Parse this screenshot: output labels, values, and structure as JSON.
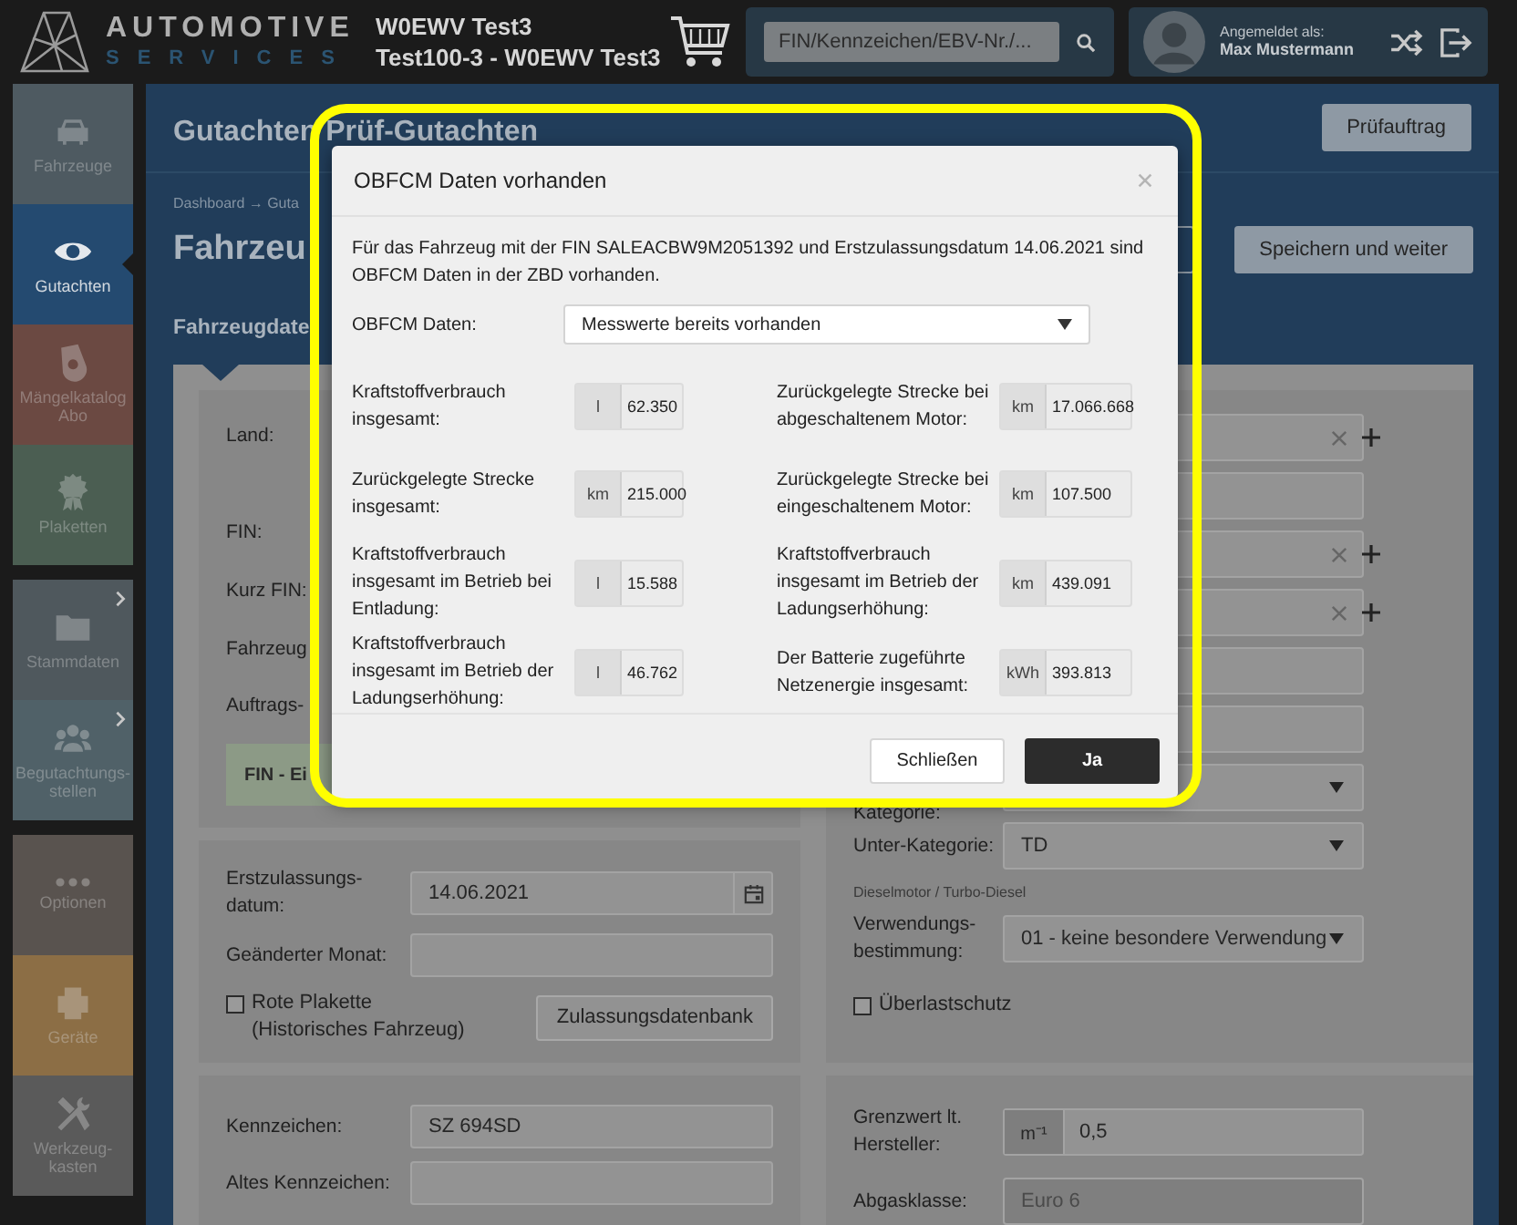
{
  "header": {
    "logo": {
      "name": "AUTOMOTIVE",
      "tagline": "SERVICES"
    },
    "context_lines": [
      "W0EWV Test3",
      "Test100-3 - W0EWV Test3"
    ],
    "search": {
      "placeholder": "FIN/Kennzeichen/EBV-Nr./..."
    },
    "user": {
      "caption": "Angemeldet als:",
      "name": "Max Mustermann"
    }
  },
  "sidebar": {
    "groups": [
      {
        "items": [
          {
            "label": "Fahrzeuge",
            "color": "#4e5a61",
            "selected": false,
            "expandable": false
          },
          {
            "label": "Gutachten",
            "color": "#244a70",
            "selected": true,
            "expandable": false
          },
          {
            "label": "Mängelkatalog Abo",
            "color": "#6b4942",
            "selected": false,
            "expandable": false
          },
          {
            "label": "Plaketten",
            "color": "#4b5e52",
            "selected": false,
            "expandable": false
          }
        ]
      },
      {
        "items": [
          {
            "label": "Stammdaten",
            "color": "#4f585d",
            "selected": false,
            "expandable": true
          },
          {
            "label": "Begutachtungs-stellen",
            "color": "#506168",
            "selected": false,
            "expandable": true
          }
        ]
      },
      {
        "items": [
          {
            "label": "Optionen",
            "color": "#59534f",
            "selected": false,
            "expandable": false
          },
          {
            "label": "Geräte",
            "color": "#8c6e45",
            "selected": false,
            "expandable": false
          },
          {
            "label": "Werkzeug-kasten",
            "color": "#5a5a5a",
            "selected": false,
            "expandable": false
          }
        ]
      }
    ]
  },
  "page": {
    "title": "Gutachten Prüf-Gutachten",
    "title_button": "Prüfauftrag",
    "breadcrumb": "Dashboard → Guta",
    "heading": "Fahrzeu",
    "action_button": "Speichern und weiter",
    "section_title": "Fahrzeugdate"
  },
  "vehicle_form": {
    "identity_labels": [
      "Land:",
      "FIN:",
      "Kurz FIN:",
      "Fahrzeug",
      "Auftrags-"
    ],
    "fin_notice": "FIN - Ei",
    "identity_fields": [
      {
        "kind": "clearable"
      },
      {
        "kind": "text"
      },
      {
        "kind": "clearable"
      },
      {
        "kind": "clearable"
      },
      {
        "kind": "text"
      },
      {
        "kind": "text"
      }
    ],
    "category": {
      "label": "Kategorie:"
    },
    "subcategory": {
      "label": "Unter-Kategorie:",
      "value": "TD",
      "hint": "Dieselmotor / Turbo-Diesel"
    },
    "usage": {
      "label": "Verwendungs-bestimmung:",
      "value": "01 - keine besondere Verwendung"
    },
    "overload": {
      "label": "Überlastschutz",
      "checked": false
    },
    "registration": {
      "first_label": "Erstzulassungs-datum:",
      "first_value": "14.06.2021",
      "changed_month_label": "Geänderter Monat:",
      "red_plate": {
        "label": "Rote Plakette (Historisches Fahrzeug)",
        "checked": false
      },
      "database_button": "Zulassungsdatenbank"
    },
    "plates": {
      "current_label": "Kennzeichen:",
      "current_value": "SZ 694SD",
      "old_label": "Altes Kennzeichen:"
    },
    "emissions": {
      "limit_label": "Grenzwert lt. Hersteller:",
      "limit_unit": "m⁻¹",
      "limit_value": "0,5",
      "class_label": "Abgasklasse:",
      "class_value": "Euro 6",
      "class_disabled": true
    }
  },
  "modal": {
    "title": "OBFCM Daten vorhanden",
    "message": "Für das Fahrzeug mit der FIN SALEACBW9M2051392 und Erstzulassungsdatum 14.06.2021 sind OBFCM Daten in der ZBD vorhanden.",
    "select": {
      "label": "OBFCM Daten:",
      "value": "Messwerte bereits vorhanden"
    },
    "readings": [
      {
        "label": "Kraftstoffverbrauch insgesamt:",
        "unit": "l",
        "value": "62.350"
      },
      {
        "label": "Zurückgelegte Strecke bei abgeschaltenem Motor:",
        "unit": "km",
        "value": "17.066.668"
      },
      {
        "label": "Zurückgelegte Strecke insgesamt:",
        "unit": "km",
        "value": "215.000"
      },
      {
        "label": "Zurückgelegte Strecke bei eingeschaltenem Motor:",
        "unit": "km",
        "value": "107.500"
      },
      {
        "label": "Kraftstoffverbrauch insgesamt im Betrieb bei Entladung:",
        "unit": "l",
        "value": "15.588"
      },
      {
        "label": "Kraftstoffverbrauch insgesamt im Betrieb der Ladungserhöhung:",
        "unit": "km",
        "value": "439.091"
      },
      {
        "label": "Kraftstoffverbrauch insgesamt im Betrieb der Ladungserhöhung:",
        "unit": "l",
        "value": "46.762"
      },
      {
        "label": "Der Batterie zugeführte Netzenergie insgesamt:",
        "unit": "kWh",
        "value": "393.813"
      }
    ],
    "buttons": [
      {
        "label": "Schließen",
        "kind": "secondary"
      },
      {
        "label": "Ja",
        "kind": "primary"
      }
    ]
  }
}
